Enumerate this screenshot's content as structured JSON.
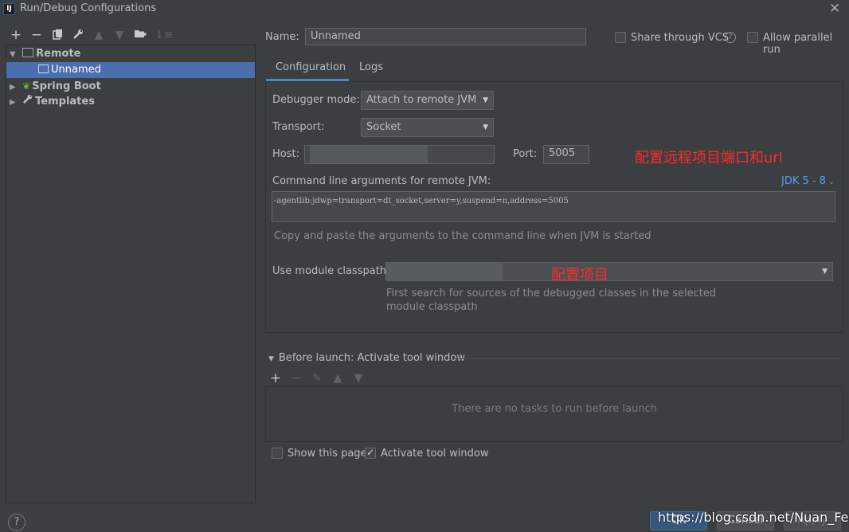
{
  "window": {
    "title": "Run/Debug Configurations",
    "app_icon": "intellij-icon",
    "app_icon_text": "IJ"
  },
  "toolbar": {
    "icons": [
      "add-icon",
      "remove-icon",
      "copy-icon",
      "wrench-icon",
      "move-up-icon",
      "move-down-icon",
      "new-folder-icon",
      "sort-icon"
    ]
  },
  "tree": {
    "remote": "Remote",
    "unnamed": "Unnamed",
    "spring_boot": "Spring Boot",
    "templates": "Templates"
  },
  "name_row": {
    "label": "Name:",
    "value": "Unnamed",
    "share_label": "Share through VCS",
    "share_checked": false,
    "parallel_label": "Allow parallel run",
    "parallel_checked": false
  },
  "tabs": [
    {
      "label": "Configuration",
      "active": true
    },
    {
      "label": "Logs",
      "active": false
    }
  ],
  "config": {
    "debugger_mode_label": "Debugger mode:",
    "debugger_mode_value": "Attach to remote JVM",
    "transport_label": "Transport:",
    "transport_value": "Socket",
    "host_label": "Host:",
    "host_value": "",
    "port_label": "Port:",
    "port_value": "5005",
    "annotation_host": "配置远程项目端口和url",
    "cmd_label": "Command line arguments for remote JVM:",
    "jdk_link": "JDK 5 - 8",
    "cmd_value": "-agentlib:jdwp=transport=dt_socket,server=y,suspend=n,address=5005",
    "cmd_hint": "Copy and paste the arguments to the command line when JVM is started",
    "module_label": "Use module classpath:",
    "module_value": "",
    "annotation_module": "配置项目",
    "module_hint_line1": "First search for sources of the debugged classes in the selected",
    "module_hint_line2": "module classpath"
  },
  "before_launch": {
    "title": "Before launch: Activate tool window",
    "icons": [
      "add-icon",
      "remove-icon",
      "edit-icon",
      "move-up-icon",
      "move-down-icon"
    ],
    "empty_text": "There are no tasks to run before launch"
  },
  "footer": {
    "show_page_label": "Show this page",
    "show_page_checked": false,
    "activate_label": "Activate tool window",
    "activate_checked": true,
    "help": "?",
    "ok_label": "OK",
    "cancel_label": "Cancel",
    "apply_label": "Apply",
    "watermark": "https://blog.csdn.net/Nuan_Feng"
  },
  "colors": {
    "background": "#3c3f41",
    "selection": "#4b6eaf",
    "accent": "#4a88c7",
    "annotation": "#ff2a2a"
  }
}
